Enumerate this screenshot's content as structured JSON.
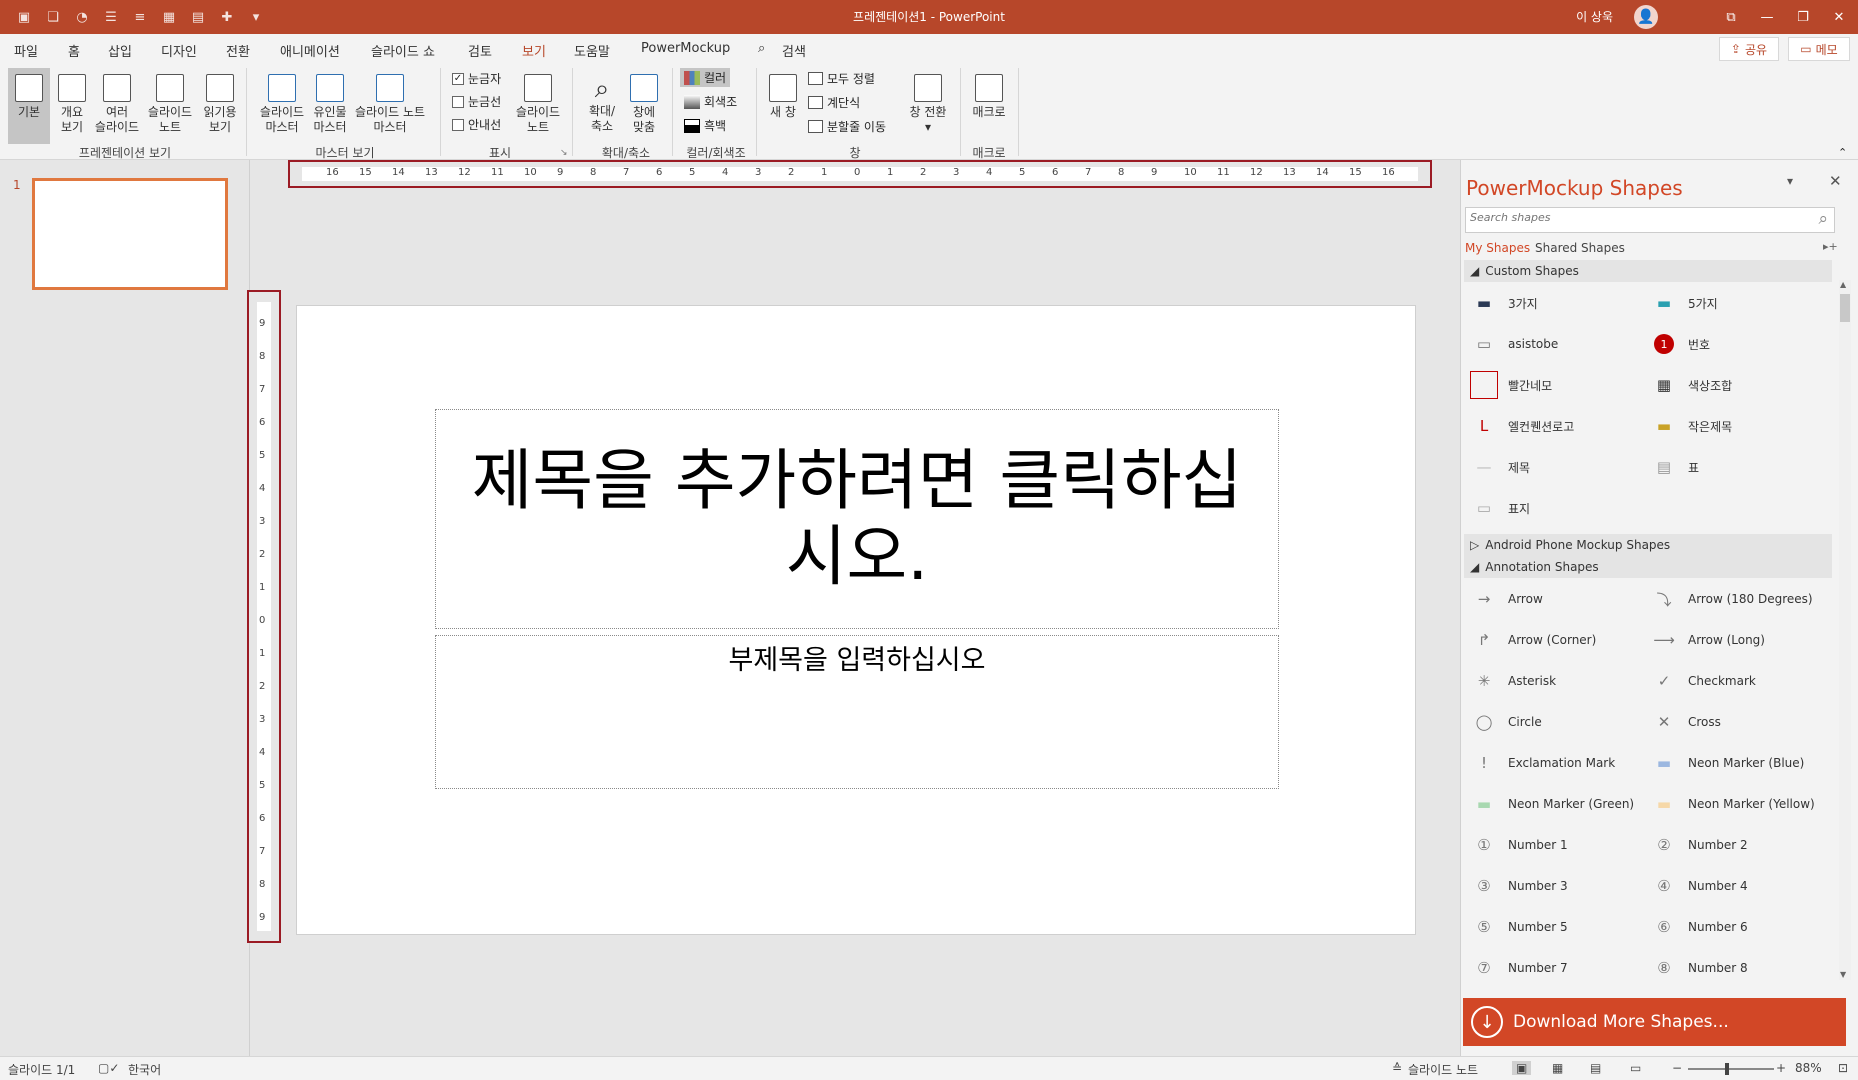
{
  "window": {
    "title": "프레젠테이션1  -  PowerPoint",
    "user": "이 상욱",
    "qa_icons": [
      "slideshow-icon",
      "copy-icon",
      "shape-icon",
      "bullet-list-icon",
      "numbered-list-icon",
      "table-icon",
      "table2-icon",
      "plus-icon",
      "dropdown-icon"
    ],
    "controls": {
      "ribbon_display": "⧉",
      "minimize": "—",
      "restore": "❐",
      "close": "✕"
    }
  },
  "tabs": [
    "파일",
    "홈",
    "삽입",
    "디자인",
    "전환",
    "애니메이션",
    "슬라이드 쇼",
    "검토",
    "보기",
    "도움말",
    "PowerMockup",
    "검색"
  ],
  "active_tab": "보기",
  "share": {
    "share_label": "공유",
    "comment_label": "메모"
  },
  "ribbon": {
    "views": [
      {
        "label1": "기본",
        "label2": ""
      },
      {
        "label1": "개요",
        "label2": "보기"
      },
      {
        "label1": "여러",
        "label2": "슬라이드"
      },
      {
        "label1": "슬라이드",
        "label2": "노트"
      },
      {
        "label1": "읽기용",
        "label2": "보기"
      }
    ],
    "views_group": "프레젠테이션 보기",
    "masters": [
      {
        "label1": "슬라이드",
        "label2": "마스터"
      },
      {
        "label1": "유인물",
        "label2": "마스터"
      },
      {
        "label1": "슬라이드 노트",
        "label2": "마스터"
      }
    ],
    "masters_group": "마스터 보기",
    "show": {
      "ruler": "눈금자",
      "gridlines": "눈금선",
      "guides": "안내선",
      "notes1": "슬라이드",
      "notes2": "노트"
    },
    "show_group": "표시",
    "zoom": {
      "zoom1": "확대/",
      "zoom2": "축소",
      "fit1": "창에",
      "fit2": "맞춤"
    },
    "zoom_group": "확대/축소",
    "color": {
      "color": "컬러",
      "grayscale": "회색조",
      "bw": "흑백"
    },
    "color_group": "컬러/회색조",
    "window": {
      "new_window": "새 창",
      "arrange_all": "모두 정렬",
      "cascade": "계단식",
      "move_split": "분할줄 이동",
      "switch1": "창 전환"
    },
    "window_group": "창",
    "macro": {
      "label": "매크로"
    },
    "macro_group": "매크로",
    "colors": {
      "color": "#c0504d",
      "gray": "#7f7f7f",
      "bw": "#000000"
    }
  },
  "ruler": {
    "h_labels": [
      "16",
      "15",
      "14",
      "13",
      "12",
      "11",
      "10",
      "9",
      "8",
      "7",
      "6",
      "5",
      "4",
      "3",
      "2",
      "1",
      "0",
      "1",
      "2",
      "3",
      "4",
      "5",
      "6",
      "7",
      "8",
      "9",
      "10",
      "11",
      "12",
      "13",
      "14",
      "15",
      "16"
    ],
    "v_labels": [
      "9",
      "8",
      "7",
      "6",
      "5",
      "4",
      "3",
      "2",
      "1",
      "0",
      "1",
      "2",
      "3",
      "4",
      "5",
      "6",
      "7",
      "8",
      "9"
    ]
  },
  "thumbnails": {
    "slide_number": "1"
  },
  "slide": {
    "title_placeholder": "제목을 추가하려면 클릭하십시오.",
    "subtitle_placeholder": "부제목을 입력하십시오"
  },
  "side_pane": {
    "title": "PowerMockup Shapes",
    "search_placeholder": "Search shapes",
    "tab_my": "My Shapes",
    "tab_shared": "Shared Shapes",
    "sections": [
      "Custom Shapes",
      "Android Phone Mockup Shapes",
      "Annotation Shapes"
    ],
    "custom_shapes": [
      "3가지",
      "5가지",
      "asistobe",
      "번호",
      "빨간네모",
      "색상조합",
      "엘컨퀜션로고",
      "작은제목",
      "제목",
      "표",
      "표지"
    ],
    "annotation_shapes": [
      "Arrow",
      "Arrow (180 Degrees)",
      "Arrow (Corner)",
      "Arrow (Long)",
      "Asterisk",
      "Checkmark",
      "Circle",
      "Cross",
      "Exclamation Mark",
      "Neon Marker (Blue)",
      "Neon Marker (Green)",
      "Neon Marker (Yellow)",
      "Number 1",
      "Number 2",
      "Number 3",
      "Number 4",
      "Number 5",
      "Number 6",
      "Number 7",
      "Number 8"
    ],
    "download": "Download More Shapes...",
    "number_badge": "1",
    "accent": "#d24726"
  },
  "status": {
    "slide_count": "슬라이드 1/1",
    "language": "한국어",
    "notes": "슬라이드 노트",
    "zoom": "88%"
  }
}
